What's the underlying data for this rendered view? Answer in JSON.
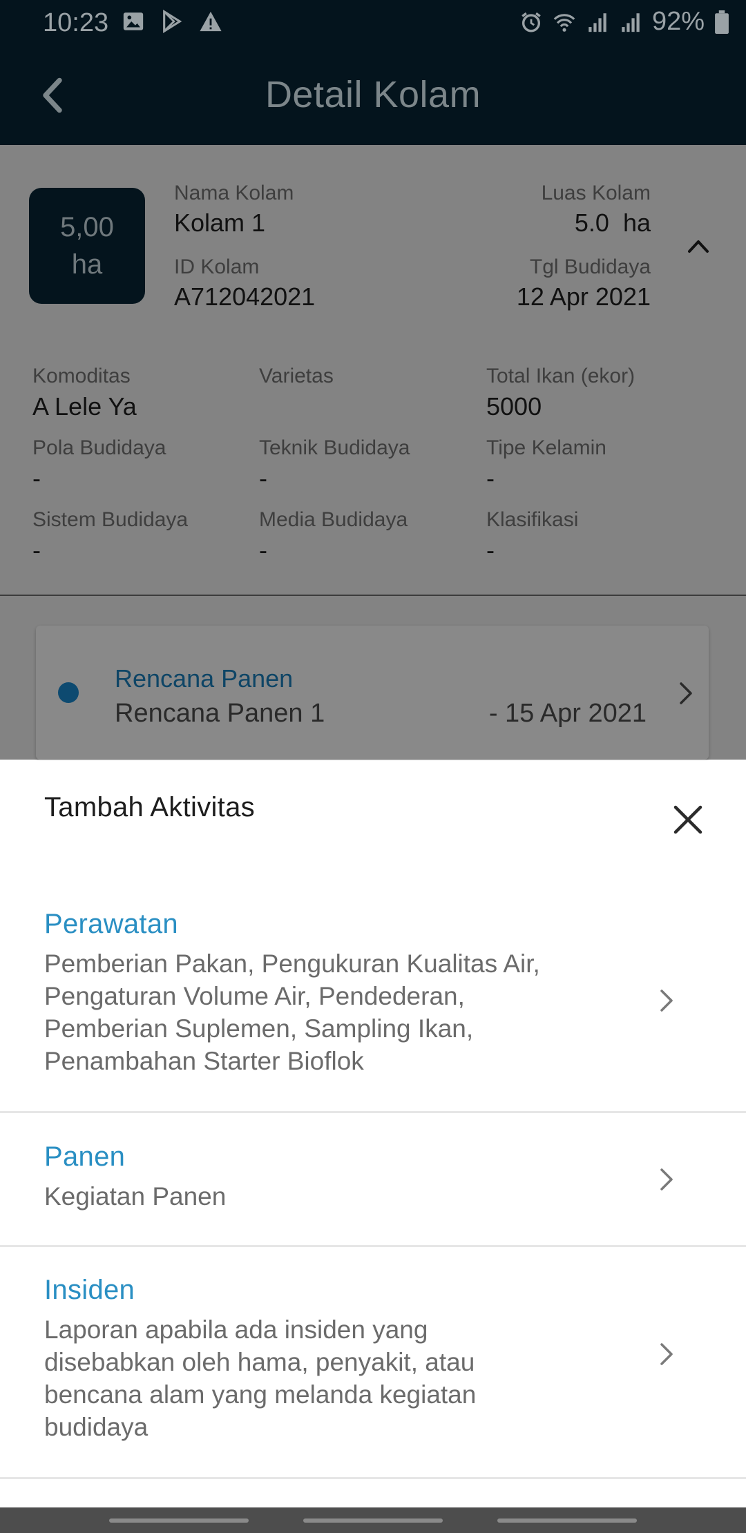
{
  "status_bar": {
    "time": "10:23",
    "battery": "92%",
    "left_icons": [
      "image-icon",
      "play-store-icon",
      "warning-icon"
    ],
    "right_icons": [
      "alarm-icon",
      "wifi-icon",
      "signal-icon",
      "signal-icon",
      "battery-icon"
    ]
  },
  "app_bar": {
    "title": "Detail Kolam"
  },
  "pond": {
    "area_value": "5,00",
    "area_unit": "ha",
    "name_label": "Nama Kolam",
    "name_value": "Kolam 1",
    "size_label": "Luas Kolam",
    "size_value": "5.0  ha",
    "id_label": "ID Kolam",
    "id_value": "A712042021",
    "date_label": "Tgl Budidaya",
    "date_value": "12 Apr 2021"
  },
  "details": [
    {
      "label": "Komoditas",
      "value": "A Lele Ya"
    },
    {
      "label": "Varietas",
      "value": ""
    },
    {
      "label": "Total Ikan (ekor)",
      "value": "5000"
    },
    {
      "label": "Pola Budidaya",
      "value": "-"
    },
    {
      "label": "Teknik Budidaya",
      "value": "-"
    },
    {
      "label": "Tipe Kelamin",
      "value": "-"
    },
    {
      "label": "Sistem Budidaya",
      "value": "-"
    },
    {
      "label": "Media Budidaya",
      "value": "-"
    },
    {
      "label": "Klasifikasi",
      "value": "-"
    }
  ],
  "harvest_plan": {
    "title": "Rencana Panen",
    "name": "Rencana Panen 1",
    "date": "- 15 Apr 2021"
  },
  "sheet": {
    "title": "Tambah Aktivitas",
    "options": [
      {
        "title": "Perawatan",
        "description": "Pemberian Pakan, Pengukuran Kualitas Air, Pengaturan Volume Air, Pendederan, Pemberian Suplemen, Sampling Ikan, Penambahan Starter Bioflok"
      },
      {
        "title": "Panen",
        "description": "Kegiatan Panen"
      },
      {
        "title": "Insiden",
        "description": "Laporan apabila ada insiden yang disebabkan oleh hama, penyakit, atau bencana alam yang melanda kegiatan budidaya"
      }
    ]
  },
  "colors": {
    "accent": "#2a8fc3",
    "header_bg": "#04141d",
    "scrim": "#838383"
  }
}
